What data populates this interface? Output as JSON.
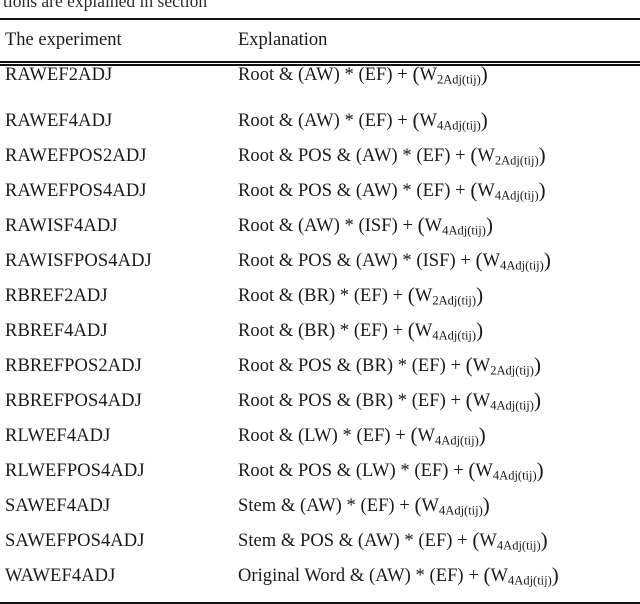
{
  "page": {
    "clipped_text_above_table": "tions are explained in section",
    "background_color": "#ffffff",
    "rule_color": "#111111"
  },
  "table": {
    "headers": [
      "The experiment",
      "Explanation"
    ],
    "rows": [
      {
        "experiment": "RAWEF2ADJ",
        "explanation_plain": "Root & (AW) * (EF) + (W2Adj(tij))",
        "prefix": "Root & (AW) * (EF) + ",
        "w_subscript": "2Adj(tij)"
      },
      {
        "experiment": "RAWEF4ADJ",
        "explanation_plain": "Root & (AW) * (EF) + (W4Adj(tij))",
        "prefix": "Root & (AW) * (EF) + ",
        "w_subscript": "4Adj(tij)"
      },
      {
        "experiment": "RAWEFPOS2ADJ",
        "explanation_plain": "Root & POS & (AW) * (EF) + (W2Adj(tij))",
        "prefix": "Root & POS & (AW) * (EF) + ",
        "w_subscript": "2Adj(tij)"
      },
      {
        "experiment": "RAWEFPOS4ADJ",
        "explanation_plain": "Root & POS & (AW) * (EF) + (W4Adj(tij))",
        "prefix": "Root & POS & (AW) * (EF) + ",
        "w_subscript": "4Adj(tij)"
      },
      {
        "experiment": "RAWISF4ADJ",
        "explanation_plain": "Root & (AW) * (ISF) + (W4Adj(tij))",
        "prefix": "Root & (AW) * (ISF) + ",
        "w_subscript": "4Adj(tij)"
      },
      {
        "experiment": "RAWISFPOS4ADJ",
        "explanation_plain": "Root & POS & (AW) * (ISF) + (W4Adj(tij))",
        "prefix": "Root & POS & (AW) * (ISF) + ",
        "w_subscript": "4Adj(tij)"
      },
      {
        "experiment": "RBREF2ADJ",
        "explanation_plain": "Root & (BR) * (EF) + (W2Adj(tij))",
        "prefix": "Root & (BR) * (EF) + ",
        "w_subscript": "2Adj(tij)"
      },
      {
        "experiment": "RBREF4ADJ",
        "explanation_plain": "Root & (BR) * (EF) + (W4Adj(tij))",
        "prefix": "Root & (BR) * (EF) + ",
        "w_subscript": "4Adj(tij)"
      },
      {
        "experiment": "RBREFPOS2ADJ",
        "explanation_plain": "Root & POS & (BR) * (EF) + (W2Adj(tij))",
        "prefix": "Root & POS & (BR) * (EF) + ",
        "w_subscript": "2Adj(tij)"
      },
      {
        "experiment": "RBREFPOS4ADJ",
        "explanation_plain": "Root & POS & (BR) * (EF) + (W4Adj(tij))",
        "prefix": "Root & POS & (BR) * (EF) + ",
        "w_subscript": "4Adj(tij)"
      },
      {
        "experiment": "RLWEF4ADJ",
        "explanation_plain": "Root & (LW) * (EF) + (W4Adj(tij))",
        "prefix": "Root & (LW) * (EF) + ",
        "w_subscript": "4Adj(tij)"
      },
      {
        "experiment": "RLWEFPOS4ADJ",
        "explanation_plain": "Root & POS & (LW) * (EF) + (W4Adj(tij))",
        "prefix": "Root & POS & (LW) * (EF) + ",
        "w_subscript": "4Adj(tij)"
      },
      {
        "experiment": "SAWEF4ADJ",
        "explanation_plain": "Stem & (AW) * (EF) + (W4Adj(tij))",
        "prefix": "Stem & (AW) * (EF) + ",
        "w_subscript": "4Adj(tij)"
      },
      {
        "experiment": "SAWEFPOS4ADJ",
        "explanation_plain": "Stem & POS & (AW) * (EF) + (W4Adj(tij))",
        "prefix": "Stem & POS & (AW) * (EF) + ",
        "w_subscript": "4Adj(tij)"
      },
      {
        "experiment": "WAWEF4ADJ",
        "explanation_plain": "Original Word & (AW) * (EF) + (W4Adj(tij))",
        "prefix": "Original Word & (AW) * (EF) + ",
        "w_subscript": "4Adj(tij)"
      }
    ],
    "w_variable": "W",
    "open_paren": "(",
    "close_paren": ")"
  }
}
